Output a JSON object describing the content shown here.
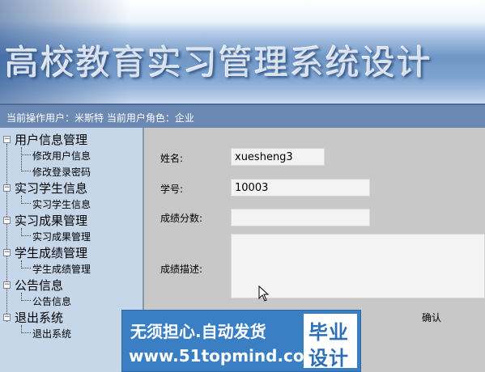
{
  "banner": {
    "title": "高校教育实习管理系统设计"
  },
  "status": {
    "text": "当前操作用户：米斯特 当前用户角色：企业"
  },
  "sidebar": {
    "groups": [
      {
        "label": "用户信息管理",
        "items": [
          "修改用户信息",
          "修改登录密码"
        ]
      },
      {
        "label": "实习学生信息",
        "items": [
          "实习学生信息"
        ]
      },
      {
        "label": "实习成果管理",
        "items": [
          "实习成果管理"
        ]
      },
      {
        "label": "学生成绩管理",
        "items": [
          "学生成绩管理"
        ]
      },
      {
        "label": "公告信息",
        "items": [
          "公告信息"
        ]
      },
      {
        "label": "退出系统",
        "items": [
          "退出系统"
        ]
      }
    ]
  },
  "form": {
    "name_label": "姓名:",
    "name_value": "xuesheng3",
    "id_label": "学号:",
    "id_value": "10003",
    "score_label": "成绩分数:",
    "score_value": "",
    "desc_label": "成绩描述:",
    "desc_value": "",
    "confirm_label": "确认"
  },
  "watermark": {
    "line1": "无须担心.自动发货",
    "line2": "www.51topmind.com",
    "badge_top": "毕业",
    "badge_bottom": "设计"
  }
}
